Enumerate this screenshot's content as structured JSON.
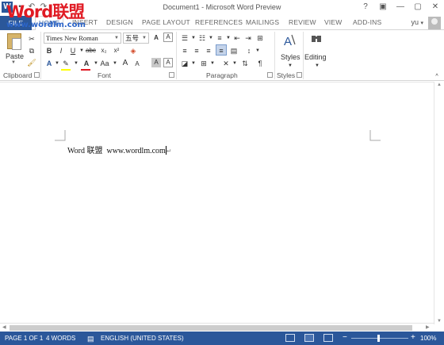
{
  "window": {
    "title": "Document1 - Microsoft Word Preview",
    "controls": [
      "?",
      "▣",
      "—",
      "▢",
      "✕"
    ]
  },
  "watermark": {
    "brand": "Word联盟",
    "url": "www.wordlm.com"
  },
  "qat": {
    "save_icon": "save-icon",
    "undo_icon": "undo-icon",
    "redo_icon": "redo-icon"
  },
  "tabs": [
    {
      "label": "FILE"
    },
    {
      "label": "HOME"
    },
    {
      "label": "INSERT"
    },
    {
      "label": "DESIGN"
    },
    {
      "label": "PAGE LAYOUT"
    },
    {
      "label": "REFERENCES"
    },
    {
      "label": "MAILINGS"
    },
    {
      "label": "REVIEW"
    },
    {
      "label": "VIEW"
    },
    {
      "label": "ADD-INS"
    }
  ],
  "user": {
    "name": "yu"
  },
  "ribbon": {
    "paste_label": "Paste",
    "font_name": "Times New Roman",
    "font_size": "五号",
    "styles_label": "Styles",
    "editing_label": "Editing",
    "group_labels": {
      "clipboard": "Clipboard",
      "font": "Font",
      "paragraph": "Paragraph",
      "styles": "Styles"
    },
    "bold": "B",
    "italic": "I",
    "underline": "U",
    "strike": "abc",
    "subscript": "x₂",
    "superscript": "x²",
    "grow_font": "A",
    "shrink_font": "A",
    "change_case": "Aa",
    "text_effects": "A",
    "font_color": "A",
    "char_shading": "A",
    "enclose_char": "A",
    "accent_colors": {
      "highlight": "#ffff00",
      "font_color": "#e01b24",
      "brand": "#2b579a"
    }
  },
  "document": {
    "text": "Word 联盟  www.wordlm.com",
    "paragraph_mark": "↵"
  },
  "status": {
    "page": "PAGE 1 OF 1",
    "words": "4 WORDS",
    "language": "ENGLISH (UNITED STATES)",
    "zoom": "100%",
    "zoom_minus": "−",
    "zoom_plus": "+"
  }
}
